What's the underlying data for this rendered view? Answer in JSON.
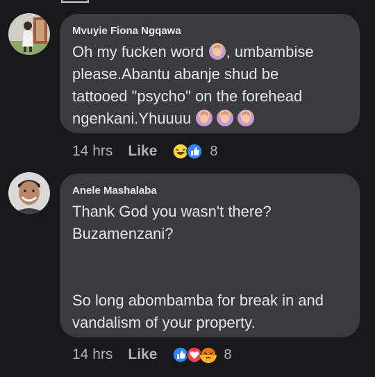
{
  "comments": [
    {
      "author": "Mvuyie Fiona Ngqawa",
      "text_parts": [
        "Oh my fucken word ",
        ", umbambise\nplease.Abantu abanje shud be\ntattooed \"psycho\" on the forehead\nngenkani.Yhuuuu "
      ],
      "time": "14 hrs",
      "like_label": "Like",
      "reaction_count": "8",
      "reaction_icons": [
        "haha-icon",
        "like-icon"
      ]
    },
    {
      "author": "Anele Mashalaba",
      "text": "Thank God you wasn't there?\nBuzamenzani?\n\n\nSo long abombamba for break in and\nvandalism of your property.",
      "time": "14 hrs",
      "like_label": "Like",
      "reaction_count": "8",
      "reaction_icons": [
        "like-icon",
        "love-icon",
        "angry-icon"
      ]
    }
  ],
  "colors": {
    "background": "#18191a",
    "bubble": "#3a3b3c",
    "text": "#e4e6eb",
    "muted": "#b0b3b8",
    "like_blue": "#2d88ff",
    "love_red": "#f33e58",
    "angry_orange": "#e9710f"
  }
}
